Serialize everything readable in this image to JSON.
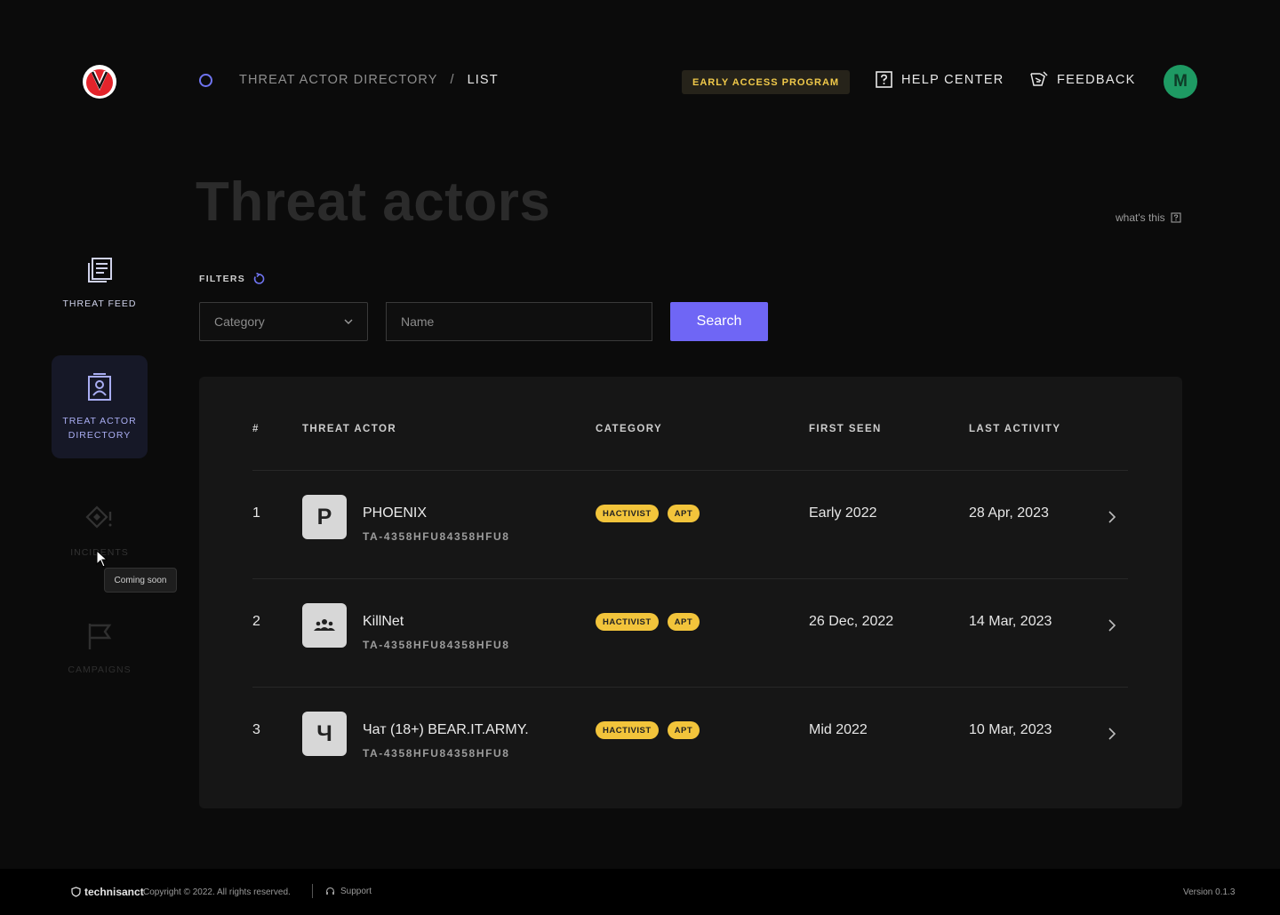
{
  "colors": {
    "accent": "#6f66f5",
    "badge": "#f2c43b",
    "avatar": "#1e9a63",
    "active_nav": "#161827"
  },
  "breadcrumb": {
    "section": "THREAT ACTOR DIRECTORY",
    "separator": "/",
    "current": "LIST"
  },
  "header": {
    "early_access": "EARLY ACCESS PROGRAM",
    "help_center": "HELP CENTER",
    "feedback": "FEEDBACK",
    "avatar_initial": "M"
  },
  "page": {
    "title": "Threat actors",
    "whats_this": "what's this"
  },
  "sidebar": {
    "items": [
      {
        "label": "THREAT FEED",
        "icon": "feed-icon"
      },
      {
        "label": "TREAT ACTOR DIRECTORY",
        "icon": "directory-icon",
        "active": true
      },
      {
        "label": "INCIDENTS",
        "icon": "incidents-icon"
      },
      {
        "label": "CAMPAIGNS",
        "icon": "flag-icon"
      }
    ],
    "tooltip": "Coming soon"
  },
  "filters": {
    "label": "FILTERS",
    "category_placeholder": "Category",
    "name_placeholder": "Name",
    "search_label": "Search"
  },
  "table": {
    "columns": [
      "#",
      "THREAT ACTOR",
      "CATEGORY",
      "FIRST SEEN",
      "LAST ACTIVITY"
    ],
    "rows": [
      {
        "num": "1",
        "avatar": "P",
        "name": "PHOENIX",
        "id": "TA-4358HFU84358HFU8",
        "tags": [
          "HACTIVIST",
          "APT"
        ],
        "first_seen": "Early 2022",
        "last_activity": "28 Apr, 2023"
      },
      {
        "num": "2",
        "avatar": "group-icon",
        "name": "KillNet",
        "id": "TA-4358HFU84358HFU8",
        "tags": [
          "HACTIVIST",
          "APT"
        ],
        "first_seen": "26 Dec, 2022",
        "last_activity": "14 Mar, 2023"
      },
      {
        "num": "3",
        "avatar": "Ч",
        "name": "Чат (18+) BEAR.IT.ARMY.",
        "id": "TA-4358HFU84358HFU8",
        "tags": [
          "HACTIVIST",
          "APT"
        ],
        "first_seen": "Mid 2022",
        "last_activity": "10 Mar, 2023"
      }
    ]
  },
  "footer": {
    "brand": "technisanct",
    "copyright": "Copyright © 2022. All rights reserved.",
    "support": "Support",
    "version": "Version 0.1.3"
  }
}
